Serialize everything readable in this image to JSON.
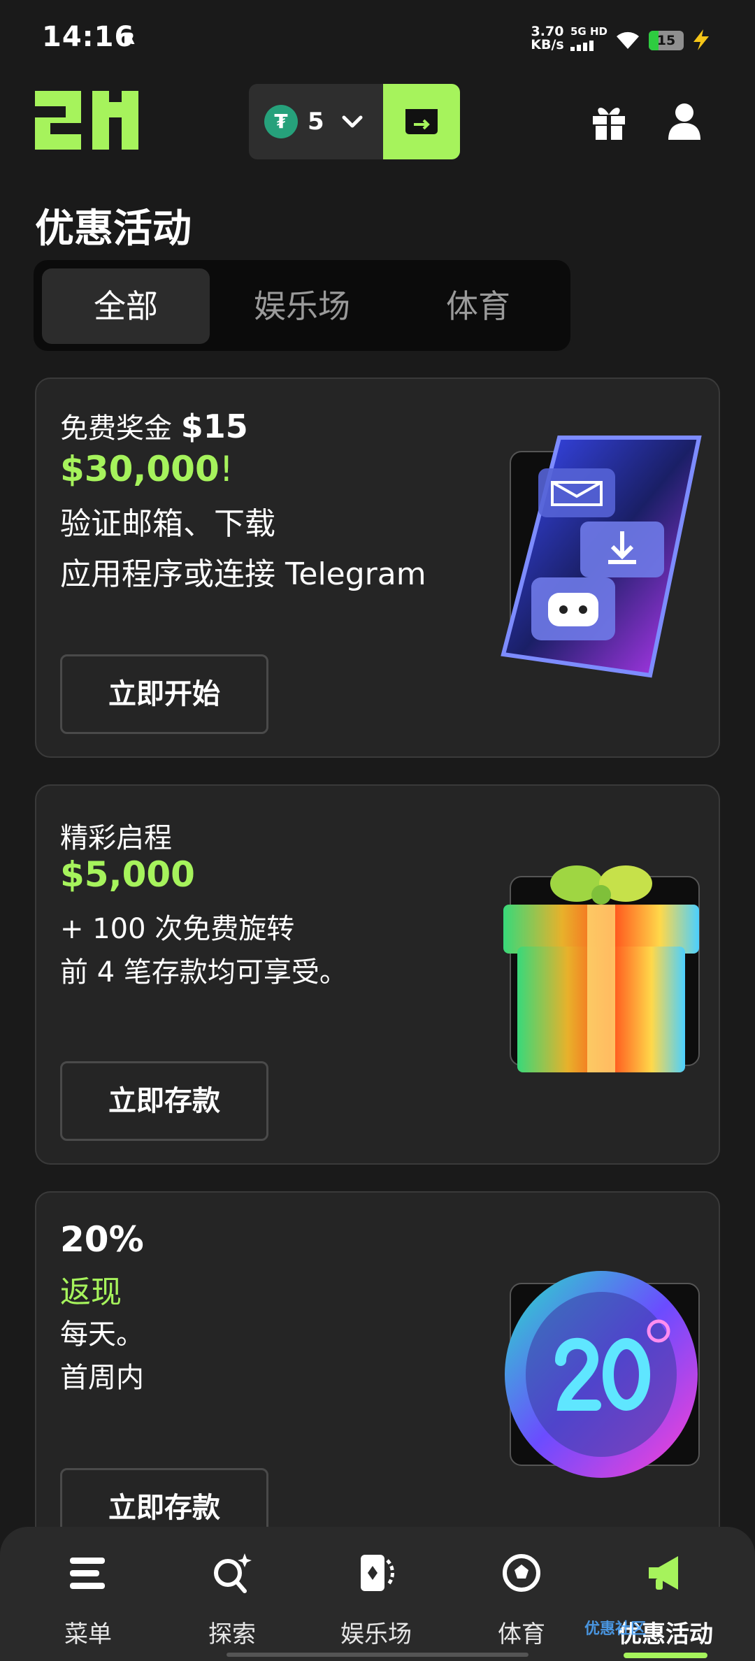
{
  "status_bar": {
    "time": "14:16",
    "r_indicator": "R",
    "speed_value": "3.70",
    "speed_unit": "KB/s",
    "network": "5G HD",
    "battery_level": "15",
    "icons": [
      "wifi-icon",
      "signal-icon",
      "battery-icon",
      "charging-icon"
    ]
  },
  "header": {
    "logo": "21",
    "wallet_amount": "5",
    "wallet_currency_icon": "tether-coin-icon",
    "icons": [
      "chevron-down-icon",
      "deposit-wallet-icon",
      "gift-icon",
      "user-icon"
    ]
  },
  "page": {
    "title": "优惠活动"
  },
  "tabs": [
    {
      "label": "全部",
      "active": true
    },
    {
      "label": "娱乐场",
      "active": false
    },
    {
      "label": "体育",
      "active": false
    }
  ],
  "promos": [
    {
      "line1_prefix": "免费奖金 ",
      "line1_bold": "$15",
      "amount": "$30,000",
      "amount_suffix": "!",
      "desc_lines": [
        "验证邮箱、下载",
        "应用程序或连接 Telegram"
      ],
      "button": "立即开始",
      "art": "phone-messages-illustration"
    },
    {
      "line1_prefix": "精彩启程",
      "amount": "$5,000",
      "desc_lines": [
        "+ 100 次免费旋转",
        "前 4 笔存款均可享受。"
      ],
      "button": "立即存款",
      "art": "gift-box-illustration"
    },
    {
      "line1_bold": "20%",
      "amount": "返现",
      "desc_lines": [
        "每天。",
        "首周内"
      ],
      "button": "立即存款",
      "art": "cashback-coin-illustration"
    }
  ],
  "bottom_nav": [
    {
      "label": "菜单",
      "icon": "menu-icon"
    },
    {
      "label": "探索",
      "icon": "search-sparkle-icon"
    },
    {
      "label": "娱乐场",
      "icon": "casino-card-icon"
    },
    {
      "label": "体育",
      "icon": "soccer-ball-icon"
    },
    {
      "label": "优惠活动",
      "icon": "megaphone-icon",
      "active": true
    }
  ],
  "watermark": "优惠社区",
  "colors": {
    "accent": "#a6f35c",
    "background": "#1a1a1a",
    "card": "#252525",
    "tether": "#26a17b"
  }
}
